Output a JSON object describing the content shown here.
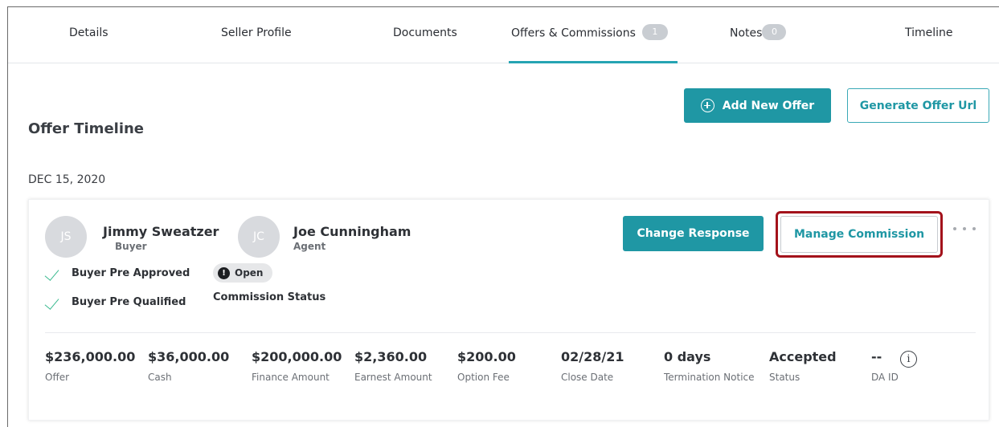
{
  "tabs": [
    {
      "label": "Details"
    },
    {
      "label": "Seller Profile"
    },
    {
      "label": "Documents"
    },
    {
      "label": "Offers & Commissions",
      "badge": "1",
      "active": true
    },
    {
      "label": "Notes",
      "badge": "0"
    },
    {
      "label": "Timeline"
    }
  ],
  "header": {
    "add_offer_label": "Add New Offer",
    "generate_url_label": "Generate Offer Url",
    "section_title": "Offer Timeline"
  },
  "timeline": {
    "date": "DEC 15, 2020",
    "offer": {
      "buyer": {
        "initials": "JS",
        "name": "Jimmy Sweatzer",
        "role": "Buyer"
      },
      "agent": {
        "initials": "JC",
        "name": "Joe Cunningham",
        "role": "Agent"
      },
      "checks": [
        "Buyer Pre Approved",
        "Buyer Pre Qualified"
      ],
      "status_pill": "Open",
      "status_caption": "Commission Status",
      "change_response_label": "Change Response",
      "manage_commission_label": "Manage Commission",
      "stats": [
        {
          "value": "$236,000.00",
          "label": "Offer"
        },
        {
          "value": "$36,000.00",
          "label": "Cash"
        },
        {
          "value": "$200,000.00",
          "label": "Finance Amount"
        },
        {
          "value": "$2,360.00",
          "label": "Earnest Amount"
        },
        {
          "value": "$200.00",
          "label": "Option Fee"
        },
        {
          "value": "02/28/21",
          "label": "Close Date"
        },
        {
          "value": "0 days",
          "label": "Termination Notice"
        },
        {
          "value": "Accepted",
          "label": "Status"
        },
        {
          "value": "--",
          "label": "DA ID"
        }
      ]
    }
  },
  "colors": {
    "accent": "#1f97a4",
    "highlight": "#a3121b",
    "check": "#3aba8f"
  },
  "icons": {
    "add": "plus-circle-icon",
    "check": "check-icon",
    "alert": "alert-icon",
    "more": "more-horizontal-icon",
    "info": "info-icon"
  }
}
